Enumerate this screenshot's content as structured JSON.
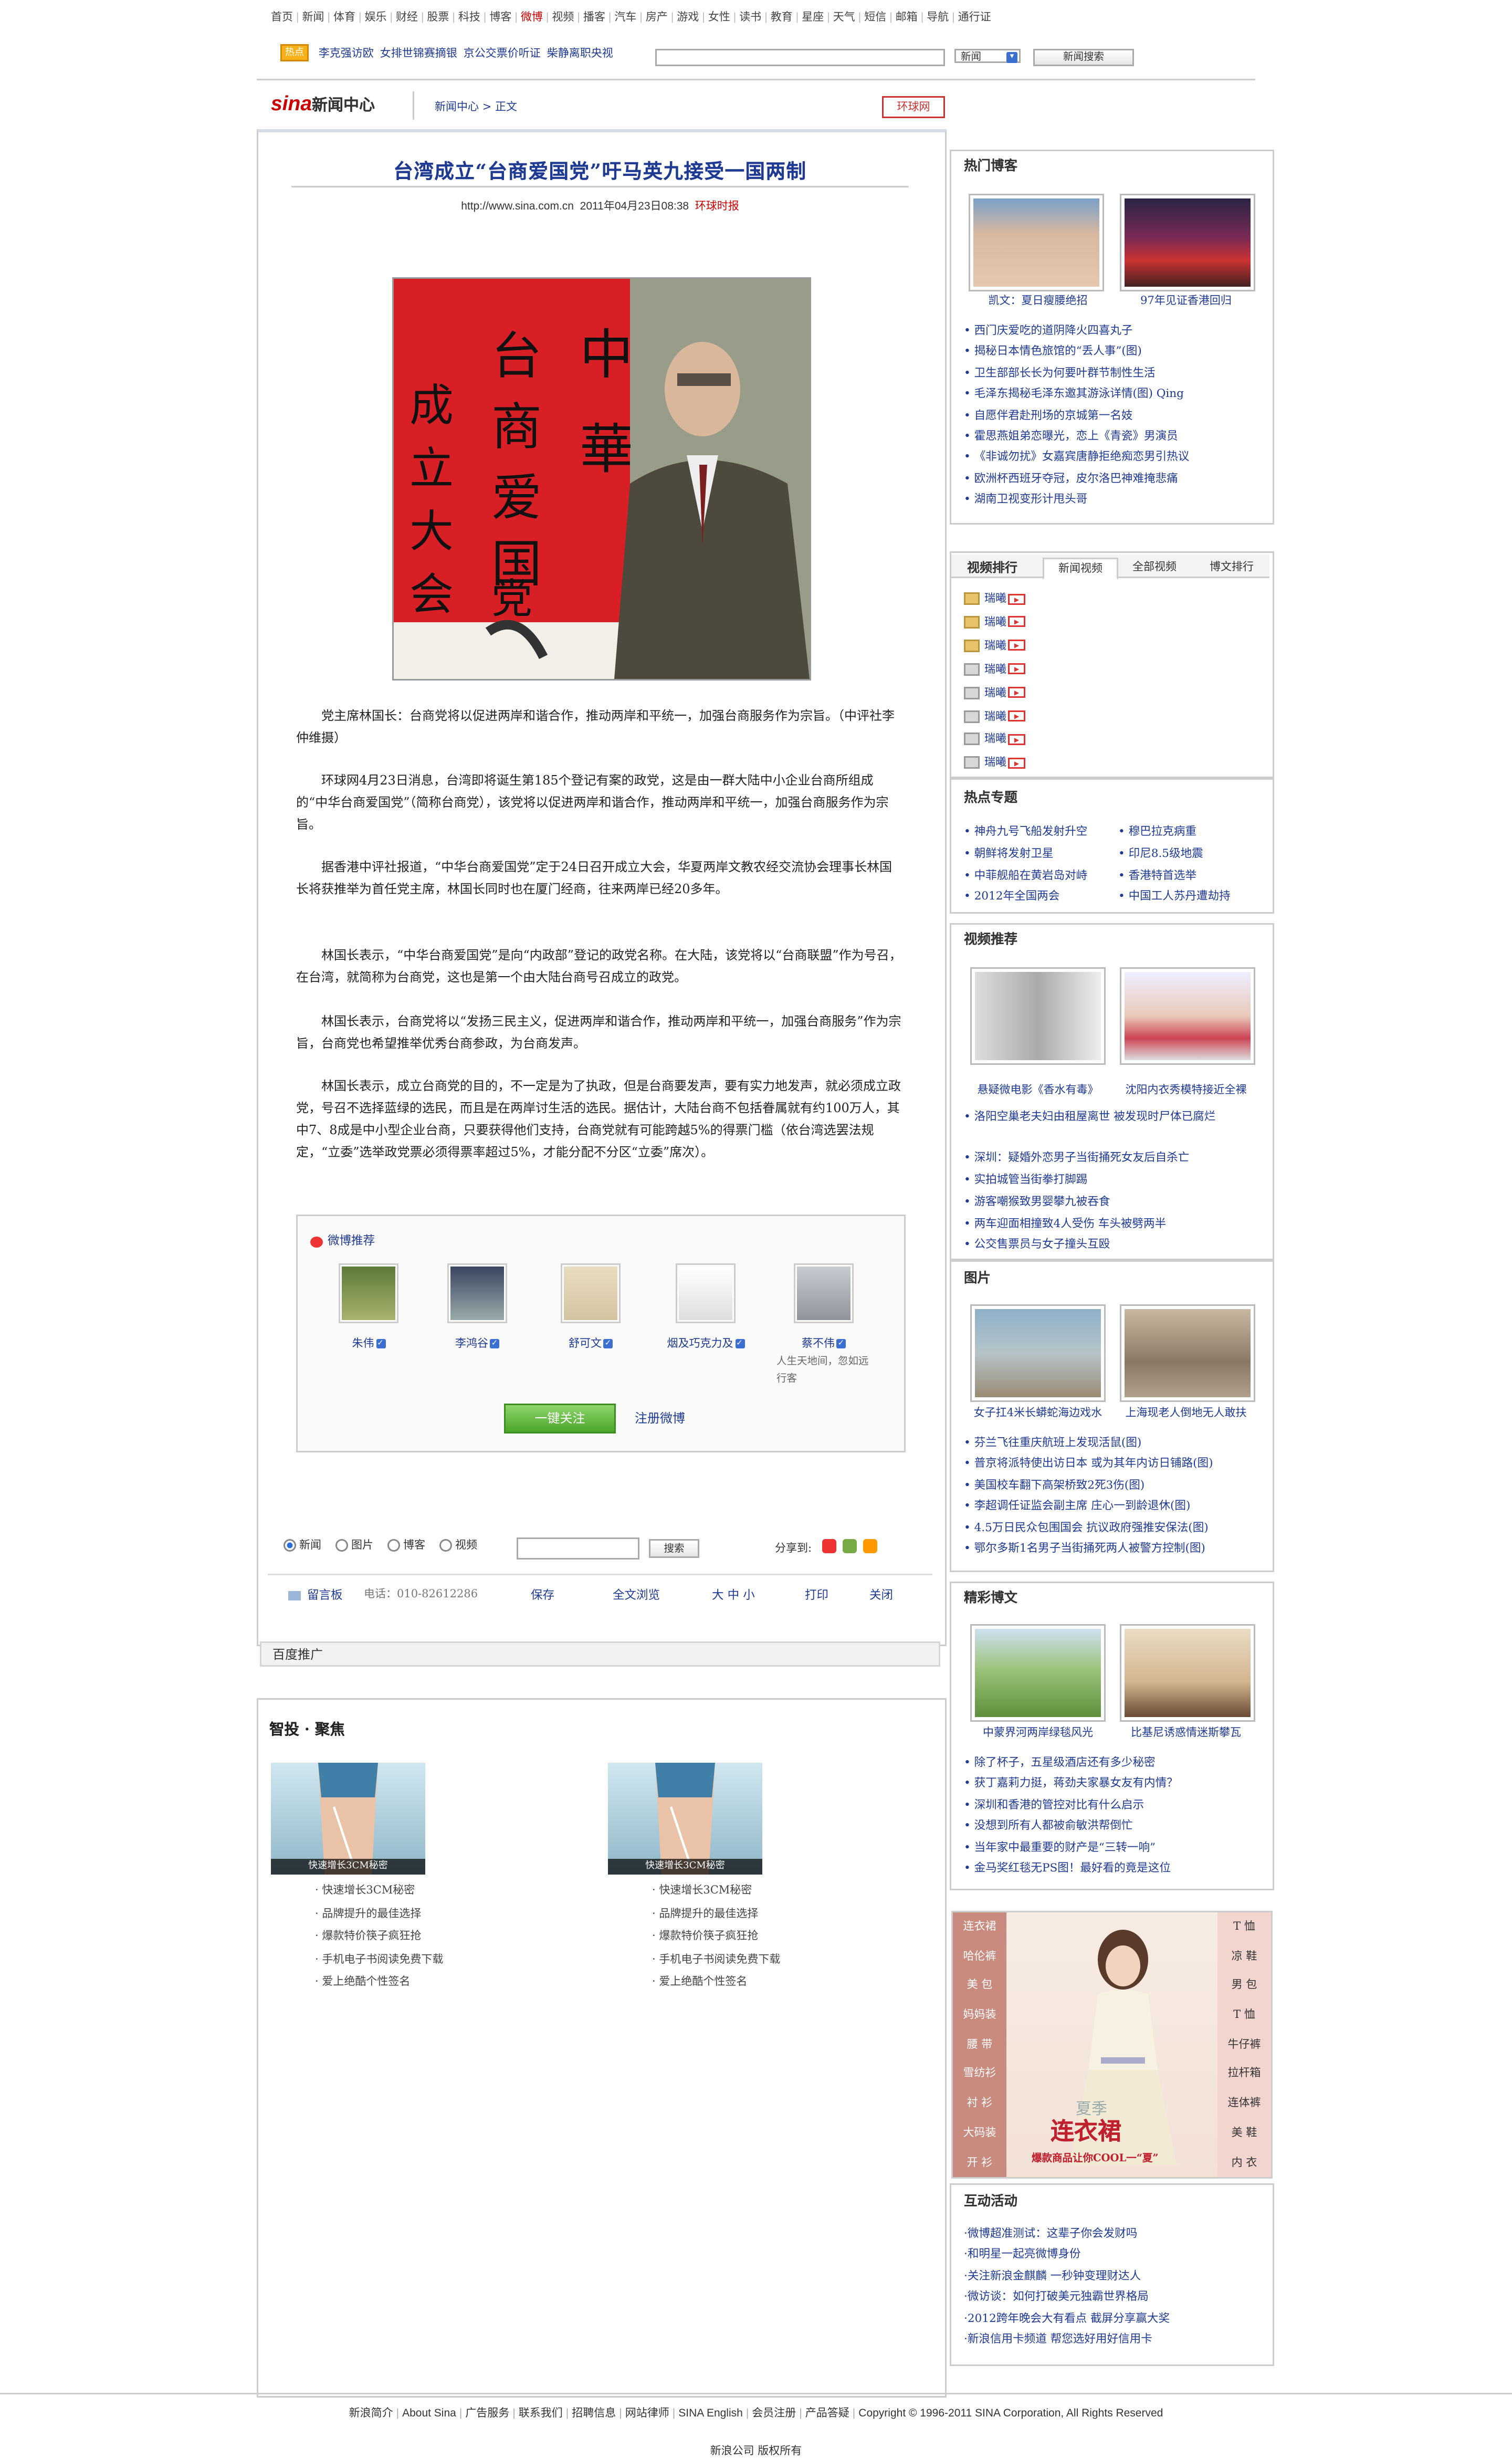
{
  "topnav": [
    "首页",
    "新闻",
    "体育",
    "娱乐",
    "财经",
    "股票",
    "科技",
    "博客",
    "微博",
    "视频",
    "播客",
    "汽车",
    "房产",
    "游戏",
    "女性",
    "读书",
    "教育",
    "星座",
    "天气",
    "短信",
    "邮箱",
    "导航",
    "通行证"
  ],
  "topnav_hot_index": 8,
  "hotbar": {
    "badge": "热点",
    "links": [
      "李克强访欧",
      "女排世锦赛摘银",
      "京公交票价听证",
      "柴静离职央视"
    ],
    "select_value": "新闻",
    "search_button": "新闻搜索"
  },
  "logo": {
    "brand": "sina",
    "sub": "新闻中心"
  },
  "breadcrumb": "新闻中心 > 正文",
  "huanqiu_logo": "环球网",
  "article": {
    "title": "台湾成立“台商爱国党”吁马英九接受一国两制",
    "url": "http://www.sina.com.cn",
    "datetime": "2011年04月23日08:38",
    "source": "环球时报",
    "photo_text": "中華台商爱国党成立大会",
    "paragraphs": [
      "党主席林国长：台商党将以促进两岸和谐合作，推动两岸和平统一，加强台商服务作为宗旨。（中评社李仲维摄）",
      "环球网4月23日消息，台湾即将诞生第185个登记有案的政党，这是由一群大陆中小企业台商所组成的“中华台商爱国党”（简称台商党），该党将以促进两岸和谐合作，推动两岸和平统一，加强台商服务作为宗旨。",
      "据香港中评社报道，“中华台商爱国党”定于24日召开成立大会，华夏两岸文教农经交流协会理事长林国长将获推举为首任党主席，林国长同时也在厦门经商，往来两岸已经20多年。",
      "林国长表示，“中华台商爱国党”是向“内政部”登记的政党名称。在大陆，该党将以“台商联盟”作为号召，在台湾，就简称为台商党，这也是第一个由大陆台商号召成立的政党。",
      "林国长表示，台商党将以“发扬三民主义，促进两岸和谐合作，推动两岸和平统一，加强台商服务”作为宗旨，台商党也希望推举优秀台商参政，为台商发声。",
      "林国长表示，成立台商党的目的，不一定是为了执政，但是台商要发声，要有实力地发声，就必须成立政党，号召不选择蓝绿的选民，而且是在两岸讨生活的选民。据估计，大陆台商不包括眷属就有约100万人，其中7、8成是中小型企业台商，只要获得他们支持，台商党就有可能跨越5%的得票门槛（依台湾选罢法规定，“立委”选举政党票必须得票率超过5%，才能分配不分区“立委”席次）。"
    ]
  },
  "weibo": {
    "title": "微博推荐",
    "users": [
      {
        "name": "朱伟",
        "desc": ""
      },
      {
        "name": "李鸿谷",
        "desc": ""
      },
      {
        "name": "舒可文",
        "desc": ""
      },
      {
        "name": "烟及巧克力及",
        "desc": ""
      },
      {
        "name": "蔡不伟",
        "desc": "人生天地间，忽如远行客"
      }
    ],
    "follow_button": "一键关注",
    "register_link": "注册微博"
  },
  "search2": {
    "options": [
      "新闻",
      "图片",
      "博客",
      "视频"
    ],
    "selected": "新闻",
    "button": "搜索",
    "share_label": "分享到:"
  },
  "tools": {
    "guestbook": "留言板",
    "phone": "电话：010-82612286",
    "items": [
      "保存",
      "全文浏览",
      "大 中 小",
      "打印",
      "关闭"
    ]
  },
  "baidu_title": "百度推广",
  "zhitou": {
    "title": "智投 · 聚焦",
    "blocks": [
      {
        "caption": "快速增长3CM秘密",
        "items": [
          "快速增长3CM秘密",
          "品牌提升的最佳选择",
          "爆款特价筷子疯狂抢",
          "手机电子书阅读免费下载",
          "爱上绝酷个性签名"
        ]
      },
      {
        "caption": "快速增长3CM秘密",
        "items": [
          "快速增长3CM秘密",
          "品牌提升的最佳选择",
          "爆款特价筷子疯狂抢",
          "手机电子书阅读免费下载",
          "爱上绝酷个性签名"
        ]
      }
    ]
  },
  "hot_blog": {
    "title": "热门博客",
    "captions": [
      "凯文：夏日瘦腰绝招",
      "97年见证香港回归"
    ],
    "items": [
      "西门庆爱吃的道阴降火四喜丸子",
      "揭秘日本情色旅馆的“丢人事”(图)",
      "卫生部部长长为何要叶群节制性生活",
      "毛泽东揭秘毛泽东邀其游泳详情(图) Qing",
      "自愿伴君赴刑场的京城第一名妓",
      "霍思燕姐弟恋曝光，恋上《青瓷》男演员",
      "《非诚勿扰》女嘉宾唐静拒绝痴恋男引热议",
      "欧洲杯西班牙夺冠，皮尔洛巴神难掩悲痛",
      "湖南卫视变形计甩头哥"
    ]
  },
  "video_rank": {
    "tabs": [
      "视频排行",
      "新闻视频",
      "全部视频",
      "博文排行"
    ],
    "active_tab": "新闻视频",
    "items": [
      "瑞曦",
      "瑞曦",
      "瑞曦",
      "瑞曦",
      "瑞曦",
      "瑞曦",
      "瑞曦",
      "瑞曦"
    ]
  },
  "hot_topics": {
    "title": "热点专题",
    "left": [
      "神舟九号飞船发射升空",
      "朝鲜将发射卫星",
      "中菲舰船在黄岩岛对峙",
      "2012年全国两会"
    ],
    "right": [
      "穆巴拉克病重",
      "印尼8.5级地震",
      "香港特首选举",
      "中国工人苏丹遭劫持"
    ]
  },
  "video_rec": {
    "title": "视频推荐",
    "captions": [
      "悬疑微电影《香水有毒》",
      "沈阳内衣秀模特接近全裸"
    ],
    "items": [
      "洛阳空巢老夫妇由租屋离世 被发现时尸体已腐烂",
      "深圳：疑婚外恋男子当街捅死女友后自杀亡",
      "实拍城管当街拳打脚踢",
      "游客嘲猴致男婴攀九被吞食",
      "两车迎面相撞致4人受伤 车头被劈两半",
      "公交售票员与女子撞头互殴"
    ]
  },
  "pictures": {
    "title": "图片",
    "captions": [
      "女子扛4米长蟒蛇海边戏水",
      "上海现老人倒地无人敢扶"
    ],
    "items": [
      "芬兰飞往重庆航班上发现活鼠(图)",
      "普京将派特使出访日本 或为其年内访日铺路(图)",
      "美国校车翻下高架桥致2死3伤(图)",
      "李超调任证监会副主席 庄心一到龄退休(图)",
      "4.5万日民众包围国会 抗议政府强推安保法(图)",
      "鄂尔多斯1名男子当街捅死两人被警方控制(图)"
    ]
  },
  "blog_feature": {
    "title": "精彩博文",
    "captions": [
      "中蒙界河两岸绿毯风光",
      "比基尼诱惑情迷斯攀瓦"
    ],
    "items": [
      "除了杯子，五星级酒店还有多少秘密",
      "获丁嘉莉力挺，蒋劲夫家暴女友有内情？",
      "深圳和香港的管控对比有什么启示",
      "没想到所有人都被俞敏洪帮倒忙",
      "当年家中最重要的财产是“三转一响”",
      "金马奖红毯无PS图！最好看的竟是这位"
    ]
  },
  "ad_tall": {
    "left": [
      "连衣裙",
      "哈伦裤",
      "美 包",
      "妈妈装",
      "腰 带",
      "雪纺衫",
      "衬 衫",
      "大码装",
      "开 衫"
    ],
    "right": [
      "T 恤",
      "凉 鞋",
      "男 包",
      "T 恤",
      "牛仔裤",
      "拉杆箱",
      "连体裤",
      "美 鞋",
      "内 衣"
    ],
    "season": "夏季",
    "headline": "连衣裙",
    "slogan": "爆款商品让你COOL一“夏”"
  },
  "interactive": {
    "title": "互动活动",
    "items": [
      "·微博超准测试：这辈子你会发财吗",
      "·和明星一起亮微博身份",
      "·关注新浪金麒麟 一秒钟变理财达人",
      "·微访谈：如何打破美元独霸世界格局",
      "·2012跨年晚会大有看点 截屏分享赢大奖",
      "·新浪信用卡频道 帮您选好用好信用卡"
    ]
  },
  "footer": {
    "links": [
      "新浪简介",
      "About Sina",
      "广告服务",
      "联系我们",
      "招聘信息",
      "网站律师",
      "SINA English",
      "会员注册",
      "产品答疑",
      "Copyright © 1996-2011 SINA Corporation, All Rights Reserved"
    ],
    "line2": "新浪公司 版权所有"
  },
  "colors": {
    "link": "#1f3a93",
    "accent_red": "#cc0000",
    "follow_green": "#4aa62a"
  }
}
